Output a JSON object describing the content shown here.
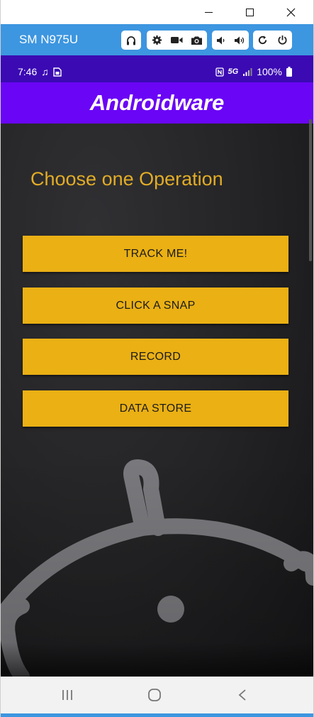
{
  "window": {
    "device_name": "SM N975U"
  },
  "toolbar": {
    "icons": [
      "headphones-icon",
      "gear-icon",
      "video-camera-icon",
      "camera-icon",
      "volume-down-icon",
      "volume-up-icon",
      "rotate-icon",
      "power-icon"
    ]
  },
  "statusbar": {
    "time": "7:46",
    "network": "5G",
    "battery": "100%"
  },
  "app": {
    "title": "Androidware",
    "heading": "Choose one Operation",
    "buttons": {
      "track": "TRACK ME!",
      "snap": "CLICK A SNAP",
      "record": "RECORD",
      "data": "DATA STORE"
    }
  },
  "colors": {
    "accent_button": "#eab014",
    "heading_text": "#e2ac26",
    "app_bar": "#6a05f5",
    "status_bar": "#3b0ab3",
    "toolbar": "#3d96e0"
  }
}
